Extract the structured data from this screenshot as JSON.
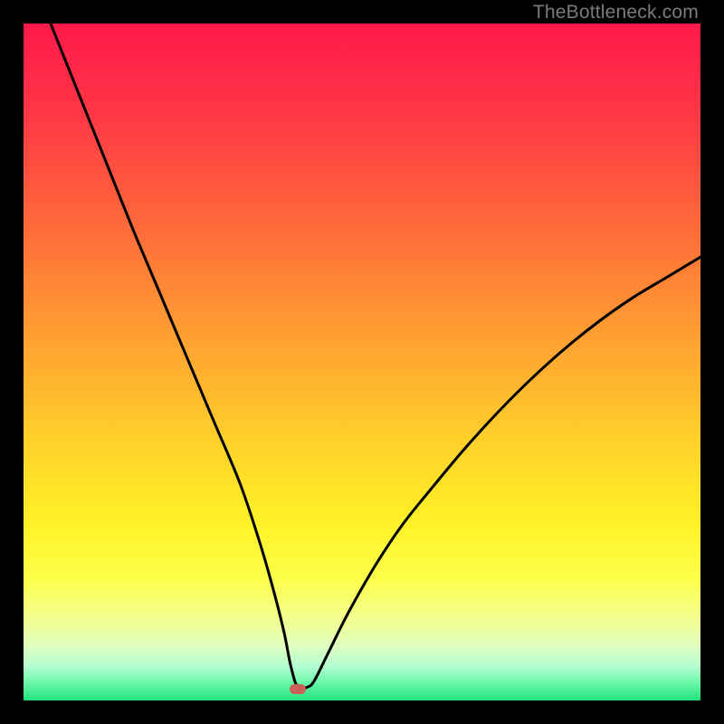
{
  "watermark": "TheBottleneck.com",
  "marker": {
    "x_pct": 40.5,
    "y_pct": 98.3,
    "w": 18,
    "h": 11
  },
  "gradient_stops": [
    {
      "pct": 0,
      "color": "#ff1a4b"
    },
    {
      "pct": 12,
      "color": "#ff3346"
    },
    {
      "pct": 30,
      "color": "#ff6a3a"
    },
    {
      "pct": 48,
      "color": "#ffa531"
    },
    {
      "pct": 62,
      "color": "#ffd22a"
    },
    {
      "pct": 74,
      "color": "#fff227"
    },
    {
      "pct": 82,
      "color": "#fdff4a"
    },
    {
      "pct": 88,
      "color": "#f2ff8f"
    },
    {
      "pct": 92,
      "color": "#e0ffc0"
    },
    {
      "pct": 95,
      "color": "#b3ffcf"
    },
    {
      "pct": 97.5,
      "color": "#66f7a8"
    },
    {
      "pct": 100,
      "color": "#21e27a"
    }
  ],
  "chart_data": {
    "type": "line",
    "title": "",
    "xlabel": "",
    "ylabel": "",
    "xlim": [
      0,
      100
    ],
    "ylim": [
      0,
      100
    ],
    "grid": false,
    "series": [
      {
        "name": "bottleneck-curve",
        "x": [
          4,
          8,
          12,
          16,
          20,
          24,
          28,
          32,
          35,
          37,
          38.5,
          39.5,
          40.5,
          42,
          43,
          45,
          48,
          52,
          56,
          60,
          65,
          70,
          75,
          80,
          85,
          90,
          95,
          100
        ],
        "y": [
          100,
          90,
          80,
          70,
          60.5,
          51,
          41.5,
          32,
          23,
          16,
          10,
          5,
          2,
          2,
          3,
          7,
          13,
          20,
          26,
          31,
          37,
          42.5,
          47.5,
          52,
          56,
          59.5,
          62.5,
          65.5
        ]
      }
    ],
    "annotations": [
      {
        "type": "marker",
        "x": 40.5,
        "y": 1.7,
        "label": "optimal-point"
      }
    ]
  }
}
